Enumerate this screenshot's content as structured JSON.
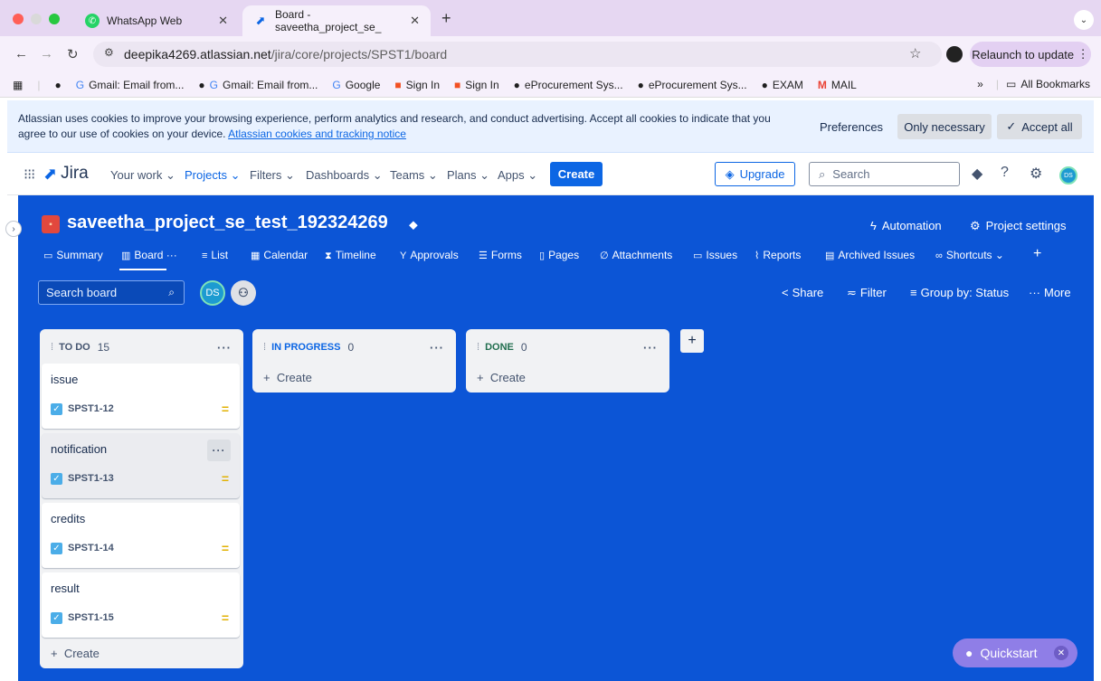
{
  "browser": {
    "tabs": [
      {
        "title": "WhatsApp Web",
        "active": false
      },
      {
        "title": "Board - saveetha_project_se_",
        "active": true
      }
    ],
    "url_host": "deepika4269.atlassian.net",
    "url_path": "/jira/core/projects/SPST1/board",
    "relaunch_label": "Relaunch to update",
    "bookmarks": [
      "Gmail: Email from...",
      "Gmail: Email from...",
      "Google",
      "Sign In",
      "Sign In",
      "eProcurement Sys...",
      "eProcurement Sys...",
      "EXAM",
      "MAIL"
    ],
    "all_bookmarks": "All Bookmarks"
  },
  "cookie_banner": {
    "text": "Atlassian uses cookies to improve your browsing experience, perform analytics and research, and conduct advertising. Accept all cookies to indicate that you agree to our use of cookies on your device.",
    "link": "Atlassian cookies and tracking notice",
    "preferences": "Preferences",
    "only_necessary": "Only necessary",
    "accept_all": "Accept all"
  },
  "topnav": {
    "product": "Jira",
    "items": [
      "Your work",
      "Projects",
      "Filters",
      "Dashboards",
      "Teams",
      "Plans",
      "Apps"
    ],
    "active_item": "Projects",
    "create": "Create",
    "upgrade": "Upgrade",
    "search_placeholder": "Search",
    "avatar_initials": "DS"
  },
  "project": {
    "name": "saveetha_project_se_test_192324269",
    "automation": "Automation",
    "settings": "Project settings",
    "tabs": [
      "Summary",
      "Board",
      "List",
      "Calendar",
      "Timeline",
      "Approvals",
      "Forms",
      "Pages",
      "Attachments",
      "Issues",
      "Reports",
      "Archived Issues",
      "Shortcuts"
    ],
    "active_tab": "Board"
  },
  "board": {
    "search_placeholder": "Search board",
    "avatar_initials": "DS",
    "share": "Share",
    "filter": "Filter",
    "group_by": "Group by: Status",
    "more": "More",
    "create_label": "Create",
    "columns": [
      {
        "name": "TO DO",
        "count": "15",
        "cards": [
          {
            "title": "issue",
            "key": "SPST1-12"
          },
          {
            "title": "notification",
            "key": "SPST1-13"
          },
          {
            "title": "credits",
            "key": "SPST1-14"
          },
          {
            "title": "result",
            "key": "SPST1-15"
          }
        ]
      },
      {
        "name": "IN PROGRESS",
        "count": "0",
        "cards": []
      },
      {
        "name": "DONE",
        "count": "0",
        "cards": []
      }
    ]
  },
  "quickstart": "Quickstart",
  "colors": {
    "board_bg": "#0c55d6",
    "primary": "#0c66e4",
    "quickstart": "#8f7ee7"
  }
}
